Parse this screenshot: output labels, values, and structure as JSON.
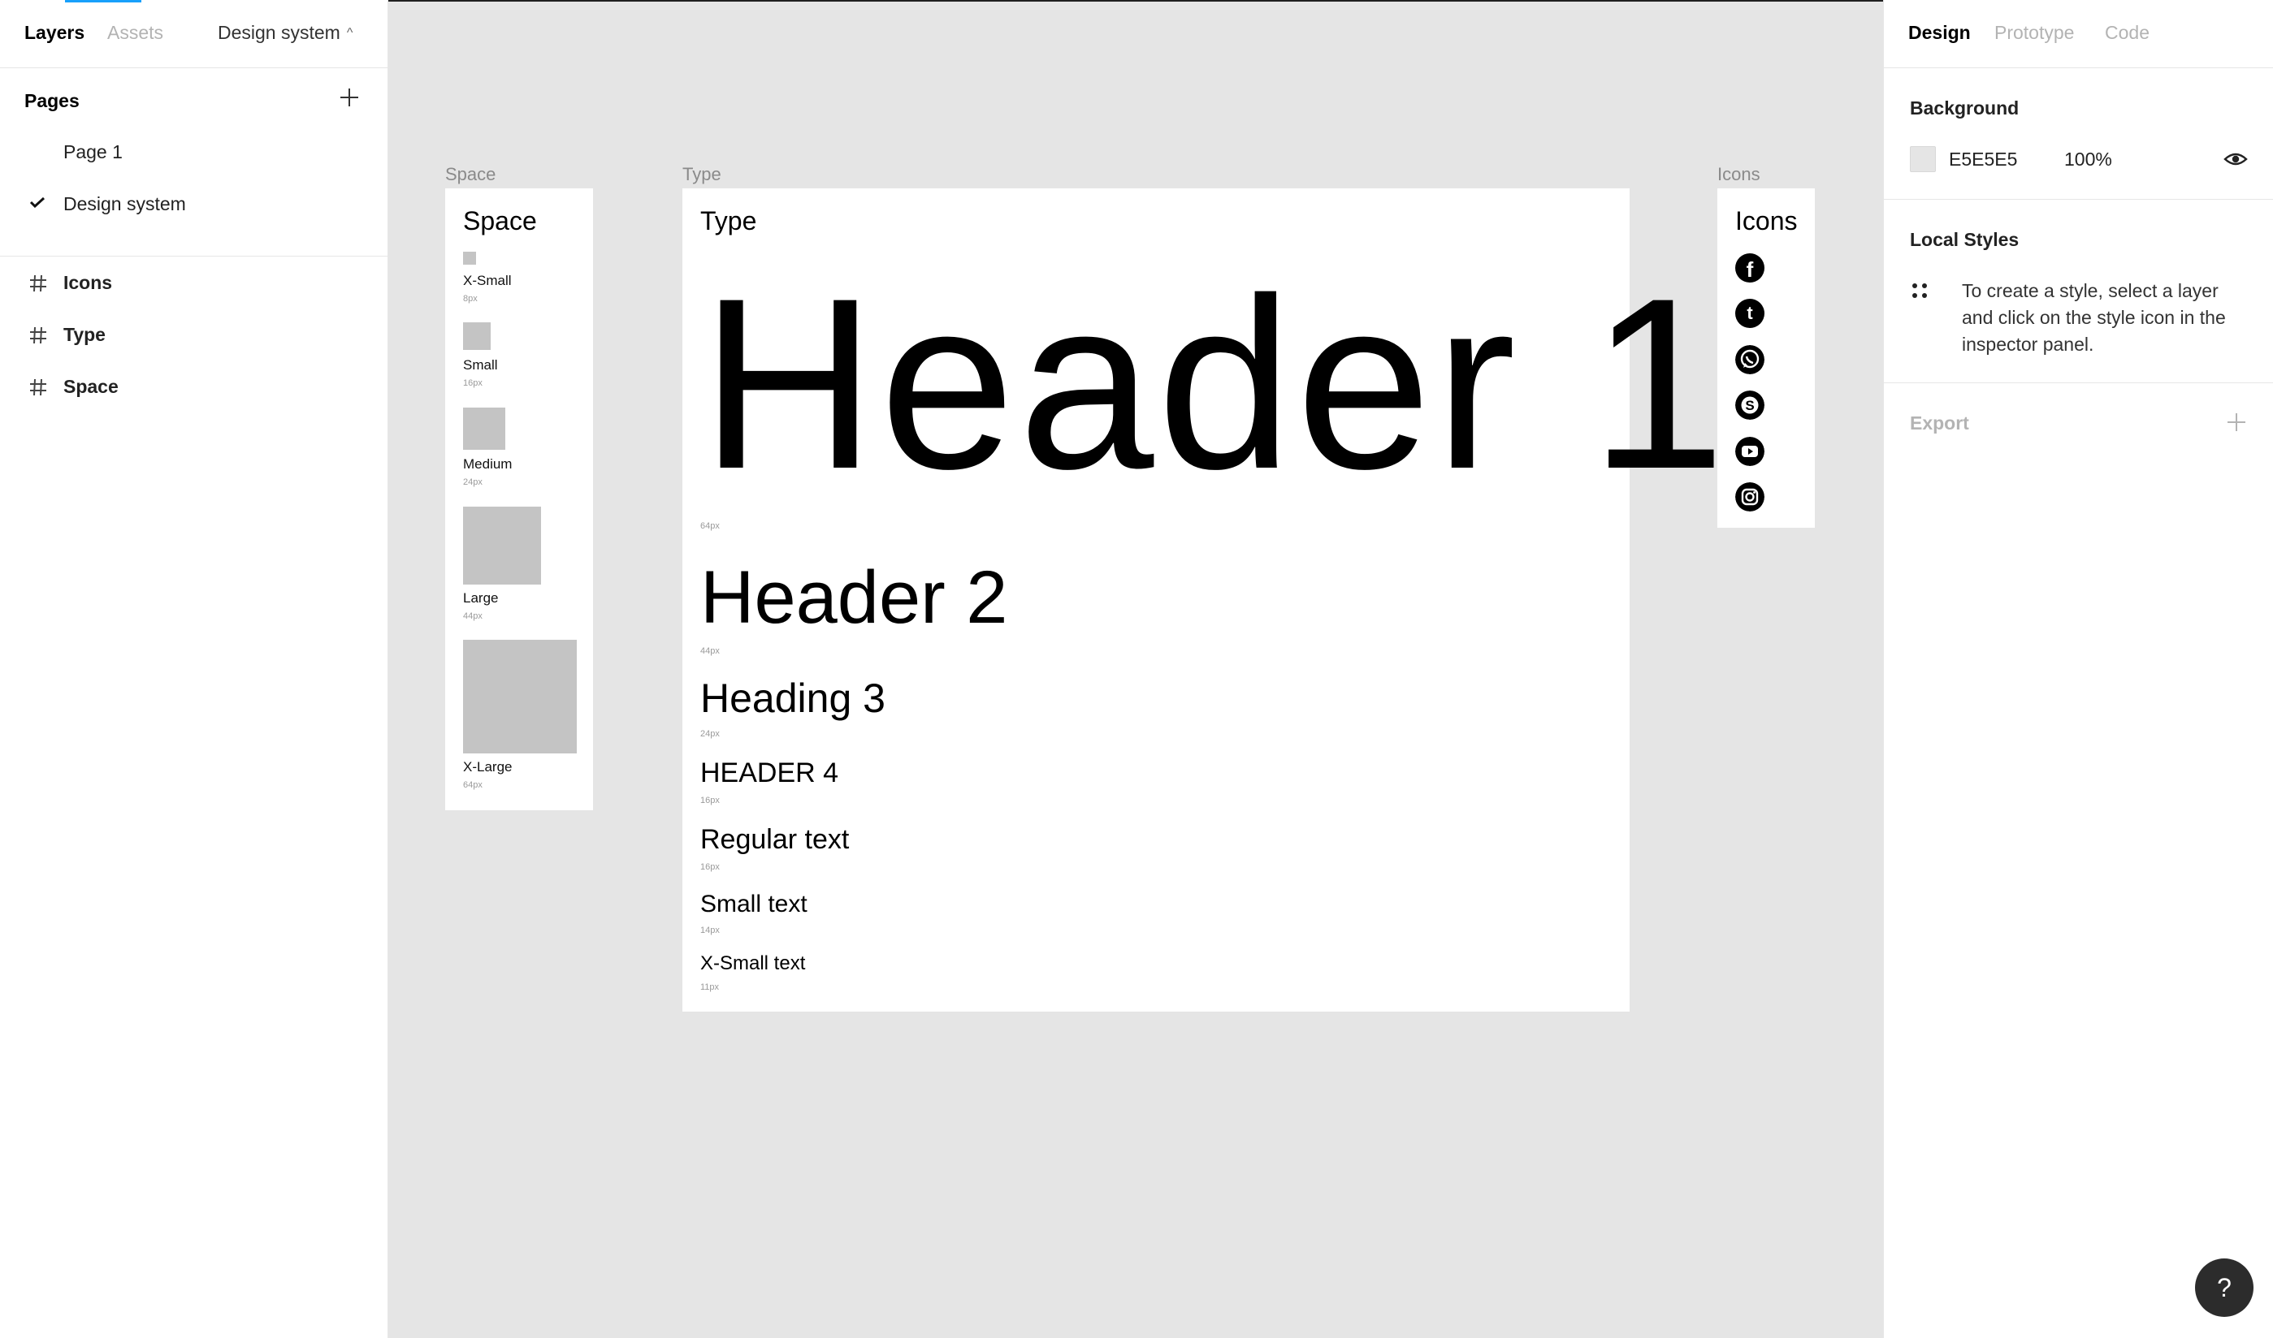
{
  "left_panel": {
    "tabs": {
      "layers": "Layers",
      "assets": "Assets"
    },
    "current_page": "Design system",
    "pages_title": "Pages",
    "pages": [
      {
        "label": "Page 1",
        "selected": false
      },
      {
        "label": "Design system",
        "selected": true
      }
    ],
    "layers": [
      {
        "label": "Icons",
        "icon": "frame-hash-icon"
      },
      {
        "label": "Type",
        "icon": "frame-hash-icon"
      },
      {
        "label": "Space",
        "icon": "frame-hash-icon"
      }
    ]
  },
  "right_panel": {
    "tabs": {
      "design": "Design",
      "prototype": "Prototype",
      "code": "Code"
    },
    "background": {
      "title": "Background",
      "hex": "E5E5E5",
      "opacity": "100%",
      "swatch_color": "#E5E5E5"
    },
    "local_styles": {
      "title": "Local Styles",
      "hint": "To create a style, select a layer and click on the style icon in the inspector panel."
    },
    "export": {
      "title": "Export"
    },
    "help": "?"
  },
  "canvas": {
    "background_color": "#E5E5E5",
    "space_frame": {
      "label": "Space",
      "title": "Space",
      "items": [
        {
          "name": "X-Small",
          "value": "8px"
        },
        {
          "name": "Small",
          "value": "16px"
        },
        {
          "name": "Medium",
          "value": "24px"
        },
        {
          "name": "Large",
          "value": "44px"
        },
        {
          "name": "X-Large",
          "value": "64px"
        }
      ]
    },
    "type_frame": {
      "label": "Type",
      "title": "Type",
      "styles": [
        {
          "text": "Header 1",
          "size": "64px"
        },
        {
          "text": "Header 2",
          "size": "44px"
        },
        {
          "text": "Heading 3",
          "size": "24px"
        },
        {
          "text": "HEADER 4",
          "size": "16px"
        },
        {
          "text": "Regular text",
          "size": "16px"
        },
        {
          "text": "Small text",
          "size": "14px"
        },
        {
          "text": "X-Small text",
          "size": "11px"
        }
      ]
    },
    "icons_frame": {
      "label": "Icons",
      "title": "Icons",
      "icons": [
        "facebook-icon",
        "tumblr-icon",
        "whatsapp-icon",
        "skype-icon",
        "youtube-icon",
        "instagram-icon"
      ]
    }
  },
  "colors": {
    "accent": "#18A0FB",
    "placeholder": "#C4C4C4"
  }
}
